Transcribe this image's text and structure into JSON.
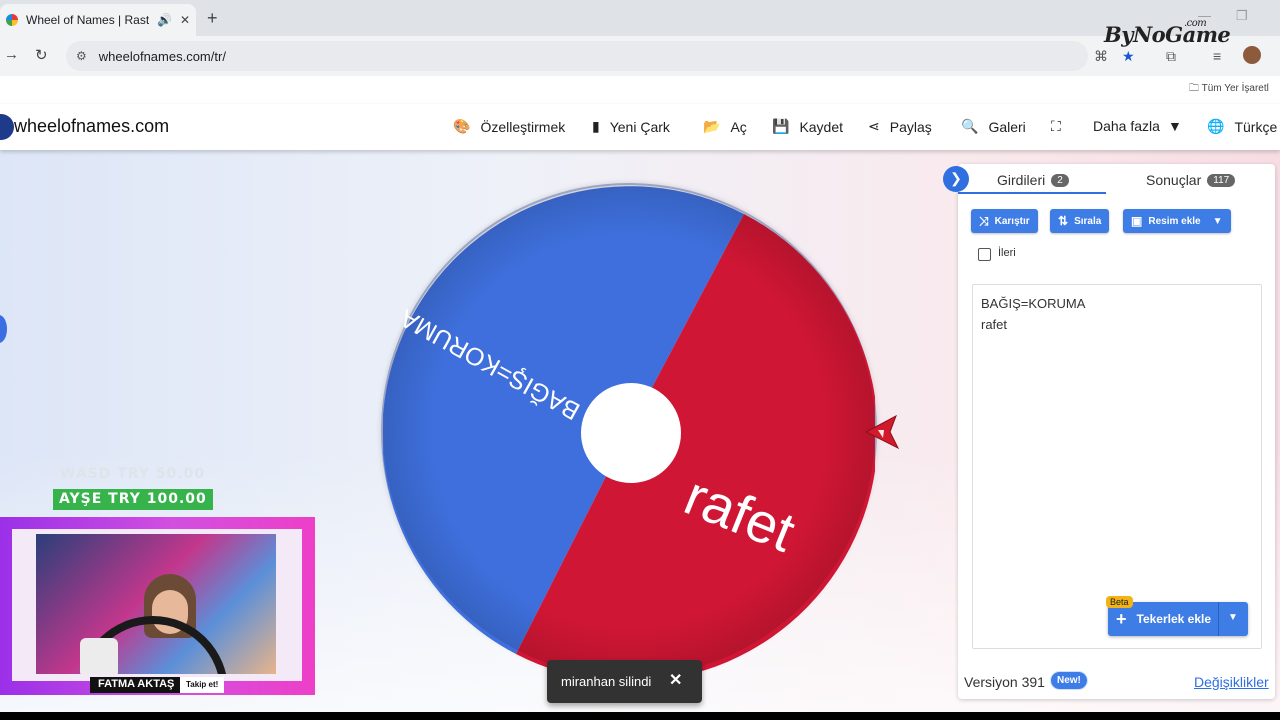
{
  "browser": {
    "tab_title": "Wheel of Names | Rastgele",
    "url": "wheelofnames.com/tr/",
    "bookmarks_label": "Tüm Yer İşaretl",
    "watermark": "ByNoGame",
    "watermark_suffix": ".com"
  },
  "site": {
    "logo": "wheelofnames.com",
    "nav": [
      {
        "label": "Özelleştirmek",
        "icon": "palette-icon"
      },
      {
        "label": "Yeni Çark",
        "icon": "file-icon"
      },
      {
        "label": "Aç",
        "icon": "folder-open-icon"
      },
      {
        "label": "Kaydet",
        "icon": "save-icon"
      },
      {
        "label": "Paylaş",
        "icon": "share-icon"
      },
      {
        "label": "Galeri",
        "icon": "search-icon"
      },
      {
        "label": "",
        "icon": "fullscreen-icon"
      },
      {
        "label": "Daha fazla",
        "icon": "caret-down-icon"
      },
      {
        "label": "Türkçe",
        "icon": "globe-icon"
      }
    ]
  },
  "wheel": {
    "segments": [
      {
        "label": "BAĞIŞ=KORUMA",
        "color": "#3e6fdc"
      },
      {
        "label": "rafet",
        "color": "#cf1634"
      }
    ]
  },
  "overlay": {
    "donation_1": "WASD TRY 50.00",
    "donation_2": "AYŞE TRY 100.00",
    "streamer_name": "FATMA AKTAŞ",
    "follow_label": "Takip et!"
  },
  "toast": {
    "message": "miranhan silindi",
    "close": "✕"
  },
  "panel": {
    "tabs": [
      {
        "label": "Girdileri",
        "count": "2"
      },
      {
        "label": "Sonuçlar",
        "count": "117"
      }
    ],
    "buttons": {
      "shuffle": "Karıştır",
      "sort": "Sırala",
      "add_image": "Resim ekle"
    },
    "advanced_label": "İleri",
    "entries": [
      "BAĞIŞ=KORUMA",
      "rafet"
    ],
    "beta_label": "Beta",
    "add_wheel": "Tekerlek ekle",
    "version": "Versiyon 391",
    "new_badge": "New!",
    "changes_link": "Değişiklikler"
  },
  "colors": {
    "accent": "#3f7de6",
    "segment_blue": "#3e6fdc",
    "segment_red": "#cf1634"
  }
}
